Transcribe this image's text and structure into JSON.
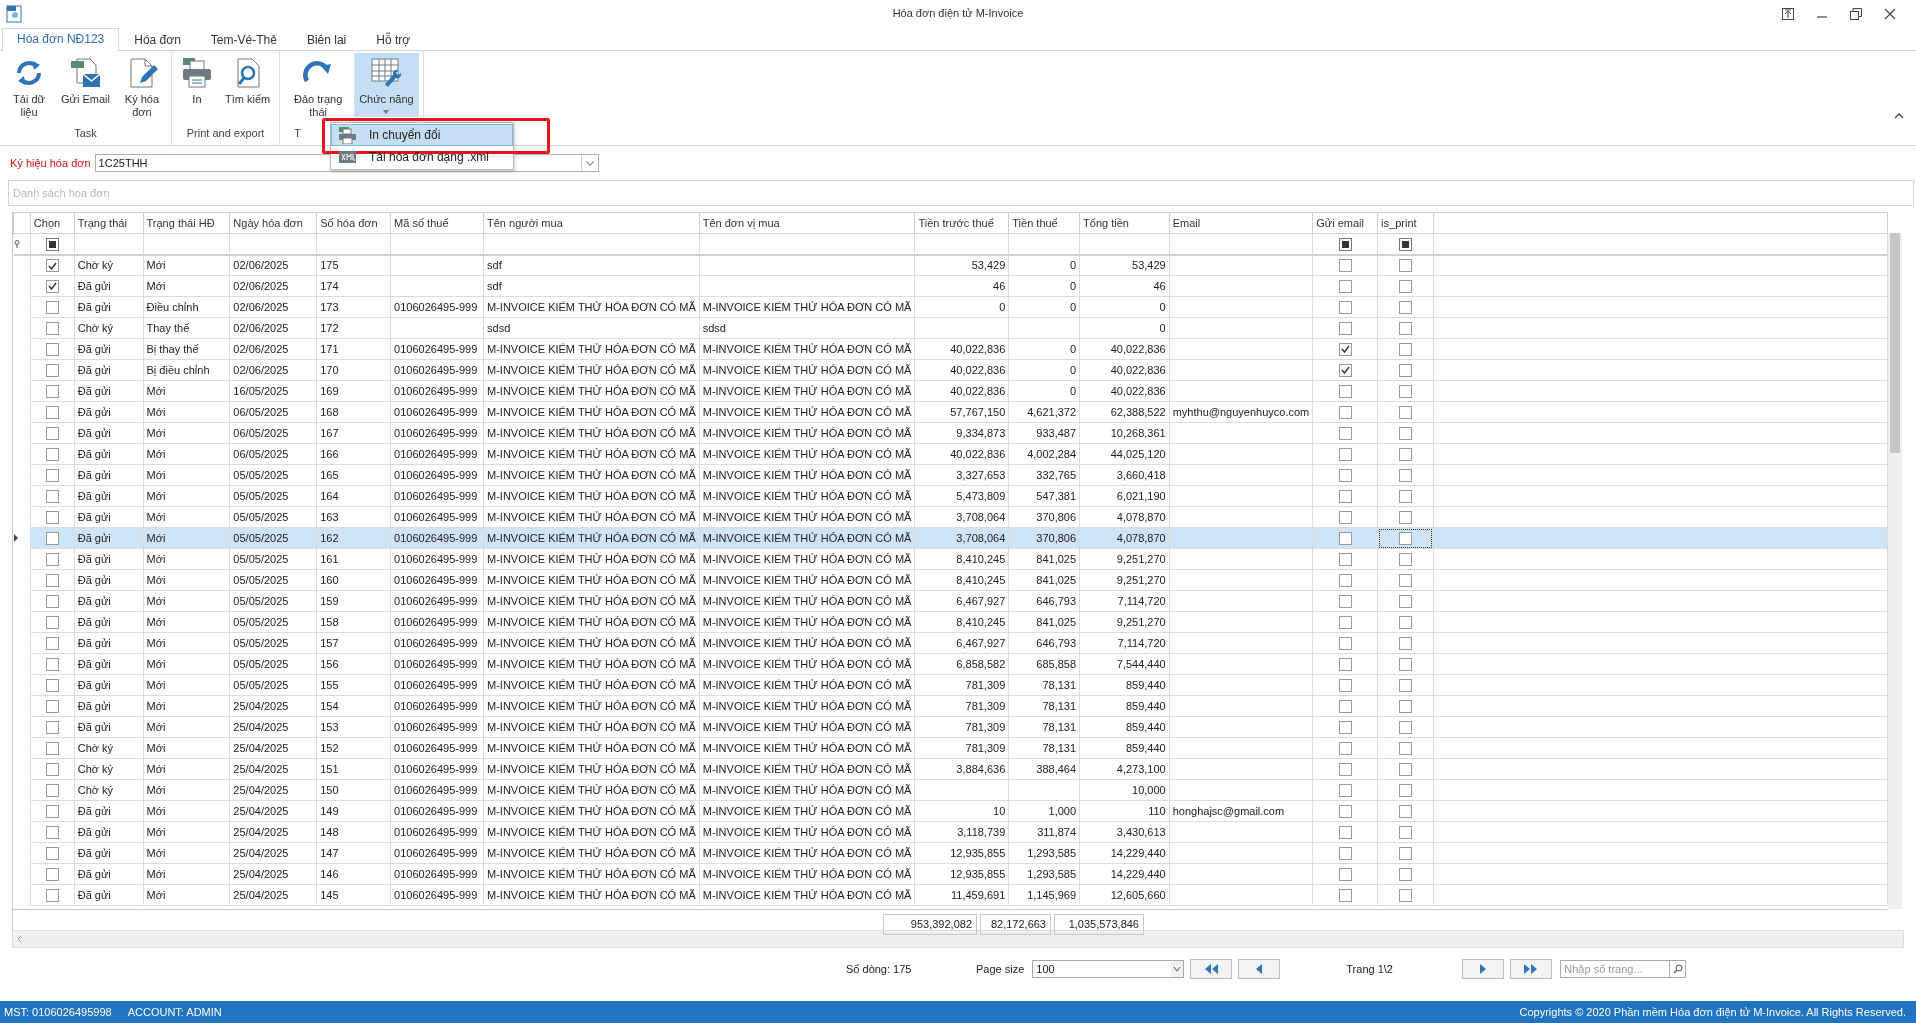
{
  "window": {
    "title": "Hóa đơn điện tử M-Invoice"
  },
  "ribbon": {
    "tabs": [
      {
        "label": "Hóa đơn NĐ123",
        "selected": true
      },
      {
        "label": "Hóa đơn",
        "selected": false
      },
      {
        "label": "Tem-Vé-Thẻ",
        "selected": false
      },
      {
        "label": "Biên lai",
        "selected": false
      },
      {
        "label": "Hỗ trợ",
        "selected": false
      }
    ],
    "groups": [
      {
        "label": "Task",
        "buttons": [
          {
            "label": "Tải dữ liệu",
            "kind": "refresh",
            "pressed": false
          },
          {
            "label": "Gửi Email",
            "kind": "mail",
            "pressed": false
          },
          {
            "label": "Ký hóa đơn",
            "kind": "sign",
            "pressed": false
          }
        ]
      },
      {
        "label": "Print and export",
        "buttons": [
          {
            "label": "In",
            "kind": "print",
            "pressed": false
          },
          {
            "label": "Tìm kiếm",
            "kind": "search",
            "pressed": false
          }
        ]
      },
      {
        "label": "T",
        "buttons": [
          {
            "label": "Đảo trạng thái",
            "kind": "redo",
            "pressed": false
          },
          {
            "label": "Chức năng",
            "kind": "tools",
            "pressed": true
          }
        ]
      }
    ]
  },
  "dropdown_menu": {
    "items": [
      {
        "label": "In chuyển đổi",
        "kind": "print",
        "selected": true,
        "annotated": true
      },
      {
        "label": "Tải hóa đơn dạng .xml",
        "kind": "xml",
        "selected": false,
        "annotated": false
      }
    ]
  },
  "invoice_symbol": {
    "label": "Ký hiệu hóa đơn",
    "value": "1C25THH"
  },
  "panel": {
    "title": "Danh sách hóa đơn"
  },
  "table": {
    "columns": [
      "Chọn",
      "Trạng thái",
      "Trạng thái HĐ",
      "Ngày hóa đơn",
      "Số hóa đơn",
      "Mã số thuế",
      "Tên người mua",
      "Tên đơn vị mua",
      "Tiền trước thuế",
      "Tiền thuế",
      "Tổng tiền",
      "Email",
      "Gửi email",
      "is_print"
    ],
    "rows": [
      {
        "selected": false,
        "checked": true,
        "status": "Chờ ký",
        "invoice_status": "Mới",
        "date": "02/06/2025",
        "number": "175",
        "buyer_name": "sdf",
        "pre_tax": "53,429",
        "tax": "0",
        "total": "53,429",
        "email_sent": false,
        "is_print": false
      },
      {
        "selected": false,
        "checked": true,
        "status": "Đã gửi",
        "invoice_status": "Mới",
        "date": "02/06/2025",
        "number": "174",
        "buyer_name": "sdf",
        "pre_tax": "46",
        "tax": "0",
        "total": "46",
        "email_sent": false,
        "is_print": false
      },
      {
        "selected": false,
        "checked": false,
        "status": "Đã gửi",
        "invoice_status": "Điều chỉnh",
        "date": "02/06/2025",
        "number": "173",
        "tax_code": "0106026495-999",
        "buyer_name": "M-INVOICE KIỂM THỬ HÓA ĐƠN CÓ MÃ",
        "buyer_unit": "M-INVOICE KIỂM THỬ HÓA ĐƠN CÓ MÃ",
        "pre_tax": "0",
        "tax": "0",
        "total": "0",
        "email_sent": false,
        "is_print": false
      },
      {
        "selected": false,
        "checked": false,
        "status": "Chờ ký",
        "invoice_status": "Thay thế",
        "date": "02/06/2025",
        "number": "172",
        "buyer_name": "sdsd",
        "buyer_unit": "sdsd",
        "total": "0",
        "email_sent": false,
        "is_print": false
      },
      {
        "selected": false,
        "checked": false,
        "status": "Đã gửi",
        "invoice_status": "Bị thay thế",
        "date": "02/06/2025",
        "number": "171",
        "tax_code": "0106026495-999",
        "buyer_name": "M-INVOICE KIỂM THỬ HÓA ĐƠN CÓ MÃ",
        "buyer_unit": "M-INVOICE KIỂM THỬ HÓA ĐƠN CÓ MÃ",
        "pre_tax": "40,022,836",
        "tax": "0",
        "total": "40,022,836",
        "email_sent": true,
        "is_print": false
      },
      {
        "selected": false,
        "checked": false,
        "status": "Đã gửi",
        "invoice_status": "Bị điều chỉnh",
        "date": "02/06/2025",
        "number": "170",
        "tax_code": "0106026495-999",
        "buyer_name": "M-INVOICE KIỂM THỬ HÓA ĐƠN CÓ MÃ",
        "buyer_unit": "M-INVOICE KIỂM THỬ HÓA ĐƠN CÓ MÃ",
        "pre_tax": "40,022,836",
        "tax": "0",
        "total": "40,022,836",
        "email_sent": true,
        "is_print": false
      },
      {
        "selected": false,
        "checked": false,
        "status": "Đã gửi",
        "invoice_status": "Mới",
        "date": "16/05/2025",
        "number": "169",
        "tax_code": "0106026495-999",
        "buyer_name": "M-INVOICE KIỂM THỬ HÓA ĐƠN CÓ MÃ",
        "buyer_unit": "M-INVOICE KIỂM THỬ HÓA ĐƠN CÓ MÃ",
        "pre_tax": "40,022,836",
        "tax": "0",
        "total": "40,022,836",
        "email_sent": false,
        "is_print": false
      },
      {
        "selected": false,
        "checked": false,
        "status": "Đã gửi",
        "invoice_status": "Mới",
        "date": "06/05/2025",
        "number": "168",
        "tax_code": "0106026495-999",
        "buyer_name": "M-INVOICE KIỂM THỬ HÓA ĐƠN CÓ MÃ",
        "buyer_unit": "M-INVOICE KIỂM THỬ HÓA ĐƠN CÓ MÃ",
        "pre_tax": "57,767,150",
        "tax": "4,621,372",
        "total": "62,388,522",
        "email": "myhthu@nguyenhuyco.com",
        "email_sent": false,
        "is_print": false
      },
      {
        "selected": false,
        "checked": false,
        "status": "Đã gửi",
        "invoice_status": "Mới",
        "date": "06/05/2025",
        "number": "167",
        "tax_code": "0106026495-999",
        "buyer_name": "M-INVOICE KIỂM THỬ HÓA ĐƠN CÓ MÃ",
        "buyer_unit": "M-INVOICE KIỂM THỬ HÓA ĐƠN CÓ MÃ",
        "pre_tax": "9,334,873",
        "tax": "933,487",
        "total": "10,268,361",
        "email_sent": false,
        "is_print": false
      },
      {
        "selected": false,
        "checked": false,
        "status": "Đã gửi",
        "invoice_status": "Mới",
        "date": "06/05/2025",
        "number": "166",
        "tax_code": "0106026495-999",
        "buyer_name": "M-INVOICE KIỂM THỬ HÓA ĐƠN CÓ MÃ",
        "buyer_unit": "M-INVOICE KIỂM THỬ HÓA ĐƠN CÓ MÃ",
        "pre_tax": "40,022,836",
        "tax": "4,002,284",
        "total": "44,025,120",
        "email_sent": false,
        "is_print": false
      },
      {
        "selected": false,
        "checked": false,
        "status": "Đã gửi",
        "invoice_status": "Mới",
        "date": "05/05/2025",
        "number": "165",
        "tax_code": "0106026495-999",
        "buyer_name": "M-INVOICE KIỂM THỬ HÓA ĐƠN CÓ MÃ",
        "buyer_unit": "M-INVOICE KIỂM THỬ HÓA ĐƠN CÓ MÃ",
        "pre_tax": "3,327,653",
        "tax": "332,765",
        "total": "3,660,418",
        "email_sent": false,
        "is_print": false
      },
      {
        "selected": false,
        "checked": false,
        "status": "Đã gửi",
        "invoice_status": "Mới",
        "date": "05/05/2025",
        "number": "164",
        "tax_code": "0106026495-999",
        "buyer_name": "M-INVOICE KIỂM THỬ HÓA ĐƠN CÓ MÃ",
        "buyer_unit": "M-INVOICE KIỂM THỬ HÓA ĐƠN CÓ MÃ",
        "pre_tax": "5,473,809",
        "tax": "547,381",
        "total": "6,021,190",
        "email_sent": false,
        "is_print": false
      },
      {
        "selected": false,
        "checked": false,
        "status": "Đã gửi",
        "invoice_status": "Mới",
        "date": "05/05/2025",
        "number": "163",
        "tax_code": "0106026495-999",
        "buyer_name": "M-INVOICE KIỂM THỬ HÓA ĐƠN CÓ MÃ",
        "buyer_unit": "M-INVOICE KIỂM THỬ HÓA ĐƠN CÓ MÃ",
        "pre_tax": "3,708,064",
        "tax": "370,806",
        "total": "4,078,870",
        "email_sent": false,
        "is_print": false
      },
      {
        "selected": true,
        "checked": false,
        "status": "Đã gửi",
        "invoice_status": "Mới",
        "date": "05/05/2025",
        "number": "162",
        "tax_code": "0106026495-999",
        "buyer_name": "M-INVOICE KIỂM THỬ HÓA ĐƠN CÓ MÃ",
        "buyer_unit": "M-INVOICE KIỂM THỬ HÓA ĐƠN CÓ MÃ",
        "pre_tax": "3,708,064",
        "tax": "370,806",
        "total": "4,078,870",
        "email_sent": false,
        "is_print": false
      },
      {
        "selected": false,
        "checked": false,
        "status": "Đã gửi",
        "invoice_status": "Mới",
        "date": "05/05/2025",
        "number": "161",
        "tax_code": "0106026495-999",
        "buyer_name": "M-INVOICE KIỂM THỬ HÓA ĐƠN CÓ MÃ",
        "buyer_unit": "M-INVOICE KIỂM THỬ HÓA ĐƠN CÓ MÃ",
        "pre_tax": "8,410,245",
        "tax": "841,025",
        "total": "9,251,270",
        "email_sent": false,
        "is_print": false
      },
      {
        "selected": false,
        "checked": false,
        "status": "Đã gửi",
        "invoice_status": "Mới",
        "date": "05/05/2025",
        "number": "160",
        "tax_code": "0106026495-999",
        "buyer_name": "M-INVOICE KIỂM THỬ HÓA ĐƠN CÓ MÃ",
        "buyer_unit": "M-INVOICE KIỂM THỬ HÓA ĐƠN CÓ MÃ",
        "pre_tax": "8,410,245",
        "tax": "841,025",
        "total": "9,251,270",
        "email_sent": false,
        "is_print": false
      },
      {
        "selected": false,
        "checked": false,
        "status": "Đã gửi",
        "invoice_status": "Mới",
        "date": "05/05/2025",
        "number": "159",
        "tax_code": "0106026495-999",
        "buyer_name": "M-INVOICE KIỂM THỬ HÓA ĐƠN CÓ MÃ",
        "buyer_unit": "M-INVOICE KIỂM THỬ HÓA ĐƠN CÓ MÃ",
        "pre_tax": "6,467,927",
        "tax": "646,793",
        "total": "7,114,720",
        "email_sent": false,
        "is_print": false
      },
      {
        "selected": false,
        "checked": false,
        "status": "Đã gửi",
        "invoice_status": "Mới",
        "date": "05/05/2025",
        "number": "158",
        "tax_code": "0106026495-999",
        "buyer_name": "M-INVOICE KIỂM THỬ HÓA ĐƠN CÓ MÃ",
        "buyer_unit": "M-INVOICE KIỂM THỬ HÓA ĐƠN CÓ MÃ",
        "pre_tax": "8,410,245",
        "tax": "841,025",
        "total": "9,251,270",
        "email_sent": false,
        "is_print": false
      },
      {
        "selected": false,
        "checked": false,
        "status": "Đã gửi",
        "invoice_status": "Mới",
        "date": "05/05/2025",
        "number": "157",
        "tax_code": "0106026495-999",
        "buyer_name": "M-INVOICE KIỂM THỬ HÓA ĐƠN CÓ MÃ",
        "buyer_unit": "M-INVOICE KIỂM THỬ HÓA ĐƠN CÓ MÃ",
        "pre_tax": "6,467,927",
        "tax": "646,793",
        "total": "7,114,720",
        "email_sent": false,
        "is_print": false
      },
      {
        "selected": false,
        "checked": false,
        "status": "Đã gửi",
        "invoice_status": "Mới",
        "date": "05/05/2025",
        "number": "156",
        "tax_code": "0106026495-999",
        "buyer_name": "M-INVOICE KIỂM THỬ HÓA ĐƠN CÓ MÃ",
        "buyer_unit": "M-INVOICE KIỂM THỬ HÓA ĐƠN CÓ MÃ",
        "pre_tax": "6,858,582",
        "tax": "685,858",
        "total": "7,544,440",
        "email_sent": false,
        "is_print": false
      },
      {
        "selected": false,
        "checked": false,
        "status": "Đã gửi",
        "invoice_status": "Mới",
        "date": "05/05/2025",
        "number": "155",
        "tax_code": "0106026495-999",
        "buyer_name": "M-INVOICE KIỂM THỬ HÓA ĐƠN CÓ MÃ",
        "buyer_unit": "M-INVOICE KIỂM THỬ HÓA ĐƠN CÓ MÃ",
        "pre_tax": "781,309",
        "tax": "78,131",
        "total": "859,440",
        "email_sent": false,
        "is_print": false
      },
      {
        "selected": false,
        "checked": false,
        "status": "Đã gửi",
        "invoice_status": "Mới",
        "date": "25/04/2025",
        "number": "154",
        "tax_code": "0106026495-999",
        "buyer_name": "M-INVOICE KIỂM THỬ HÓA ĐƠN CÓ MÃ",
        "buyer_unit": "M-INVOICE KIỂM THỬ HÓA ĐƠN CÓ MÃ",
        "pre_tax": "781,309",
        "tax": "78,131",
        "total": "859,440",
        "email_sent": false,
        "is_print": false
      },
      {
        "selected": false,
        "checked": false,
        "status": "Đã gửi",
        "invoice_status": "Mới",
        "date": "25/04/2025",
        "number": "153",
        "tax_code": "0106026495-999",
        "buyer_name": "M-INVOICE KIỂM THỬ HÓA ĐƠN CÓ MÃ",
        "buyer_unit": "M-INVOICE KIỂM THỬ HÓA ĐƠN CÓ MÃ",
        "pre_tax": "781,309",
        "tax": "78,131",
        "total": "859,440",
        "email_sent": false,
        "is_print": false
      },
      {
        "selected": false,
        "checked": false,
        "status": "Chờ ký",
        "invoice_status": "Mới",
        "date": "25/04/2025",
        "number": "152",
        "tax_code": "0106026495-999",
        "buyer_name": "M-INVOICE KIỂM THỬ HÓA ĐƠN CÓ MÃ",
        "buyer_unit": "M-INVOICE KIỂM THỬ HÓA ĐƠN CÓ MÃ",
        "pre_tax": "781,309",
        "tax": "78,131",
        "total": "859,440",
        "email_sent": false,
        "is_print": false
      },
      {
        "selected": false,
        "checked": false,
        "status": "Chờ ký",
        "invoice_status": "Mới",
        "date": "25/04/2025",
        "number": "151",
        "tax_code": "0106026495-999",
        "buyer_name": "M-INVOICE KIỂM THỬ HÓA ĐƠN CÓ MÃ",
        "buyer_unit": "M-INVOICE KIỂM THỬ HÓA ĐƠN CÓ MÃ",
        "pre_tax": "3,884,636",
        "tax": "388,464",
        "total": "4,273,100",
        "email_sent": false,
        "is_print": false
      },
      {
        "selected": false,
        "checked": false,
        "status": "Chờ ký",
        "invoice_status": "Mới",
        "date": "25/04/2025",
        "number": "150",
        "tax_code": "0106026495-999",
        "buyer_name": "M-INVOICE KIỂM THỬ HÓA ĐƠN CÓ MÃ",
        "buyer_unit": "M-INVOICE KIỂM THỬ HÓA ĐƠN CÓ MÃ",
        "total": "10,000",
        "email_sent": false,
        "is_print": false
      },
      {
        "selected": false,
        "checked": false,
        "status": "Đã gửi",
        "invoice_status": "Mới",
        "date": "25/04/2025",
        "number": "149",
        "tax_code": "0106026495-999",
        "buyer_name": "M-INVOICE KIỂM THỬ HÓA ĐƠN CÓ MÃ",
        "buyer_unit": "M-INVOICE KIỂM THỬ HÓA ĐƠN CÓ MÃ",
        "pre_tax": "10",
        "tax": "1,000",
        "total": "110",
        "email": "honghajsc@gmail.com",
        "email_sent": false,
        "is_print": false
      },
      {
        "selected": false,
        "checked": false,
        "status": "Đã gửi",
        "invoice_status": "Mới",
        "date": "25/04/2025",
        "number": "148",
        "tax_code": "0106026495-999",
        "buyer_name": "M-INVOICE KIỂM THỬ HÓA ĐƠN CÓ MÃ",
        "buyer_unit": "M-INVOICE KIỂM THỬ HÓA ĐƠN CÓ MÃ",
        "pre_tax": "3,118,739",
        "tax": "311,874",
        "total": "3,430,613",
        "email_sent": false,
        "is_print": false
      },
      {
        "selected": false,
        "checked": false,
        "status": "Đã gửi",
        "invoice_status": "Mới",
        "date": "25/04/2025",
        "number": "147",
        "tax_code": "0106026495-999",
        "buyer_name": "M-INVOICE KIỂM THỬ HÓA ĐƠN CÓ MÃ",
        "buyer_unit": "M-INVOICE KIỂM THỬ HÓA ĐƠN CÓ MÃ",
        "pre_tax": "12,935,855",
        "tax": "1,293,585",
        "total": "14,229,440",
        "email_sent": false,
        "is_print": false
      },
      {
        "selected": false,
        "checked": false,
        "status": "Đã gửi",
        "invoice_status": "Mới",
        "date": "25/04/2025",
        "number": "146",
        "tax_code": "0106026495-999",
        "buyer_name": "M-INVOICE KIỂM THỬ HÓA ĐƠN CÓ MÃ",
        "buyer_unit": "M-INVOICE KIỂM THỬ HÓA ĐƠN CÓ MÃ",
        "pre_tax": "12,935,855",
        "tax": "1,293,585",
        "total": "14,229,440",
        "email_sent": false,
        "is_print": false
      },
      {
        "selected": false,
        "checked": false,
        "status": "Đã gửi",
        "invoice_status": "Mới",
        "date": "25/04/2025",
        "number": "145",
        "tax_code": "0106026495-999",
        "buyer_name": "M-INVOICE KIỂM THỬ HÓA ĐƠN CÓ MÃ",
        "buyer_unit": "M-INVOICE KIỂM THỬ HÓA ĐƠN CÓ MÃ",
        "pre_tax": "11,459,691",
        "tax": "1,145,969",
        "total": "12,605,660",
        "email_sent": false,
        "is_print": false
      }
    ],
    "filter_checkboxes": [
      {
        "indeterminate": true
      },
      {
        "indeterminate": true
      },
      {
        "indeterminate": true
      }
    ],
    "totals": [
      "953,392,082",
      "82,172,663",
      "1,035,573,846"
    ]
  },
  "pager": {
    "row_count": "Số dòng: 175",
    "page_size_label": "Page size",
    "page_size": "100",
    "page_info": "Trang 1\\2",
    "page_input_placeholder": "Nhập số trang..."
  },
  "status_bar": {
    "tax_code": "MST: 0106026495998",
    "account": "ACCOUNT: ADMIN",
    "copyright": "Copyrights © 2020 Phần mềm Hóa đơn điện tử M-Invoice. All Rights Reserved."
  }
}
